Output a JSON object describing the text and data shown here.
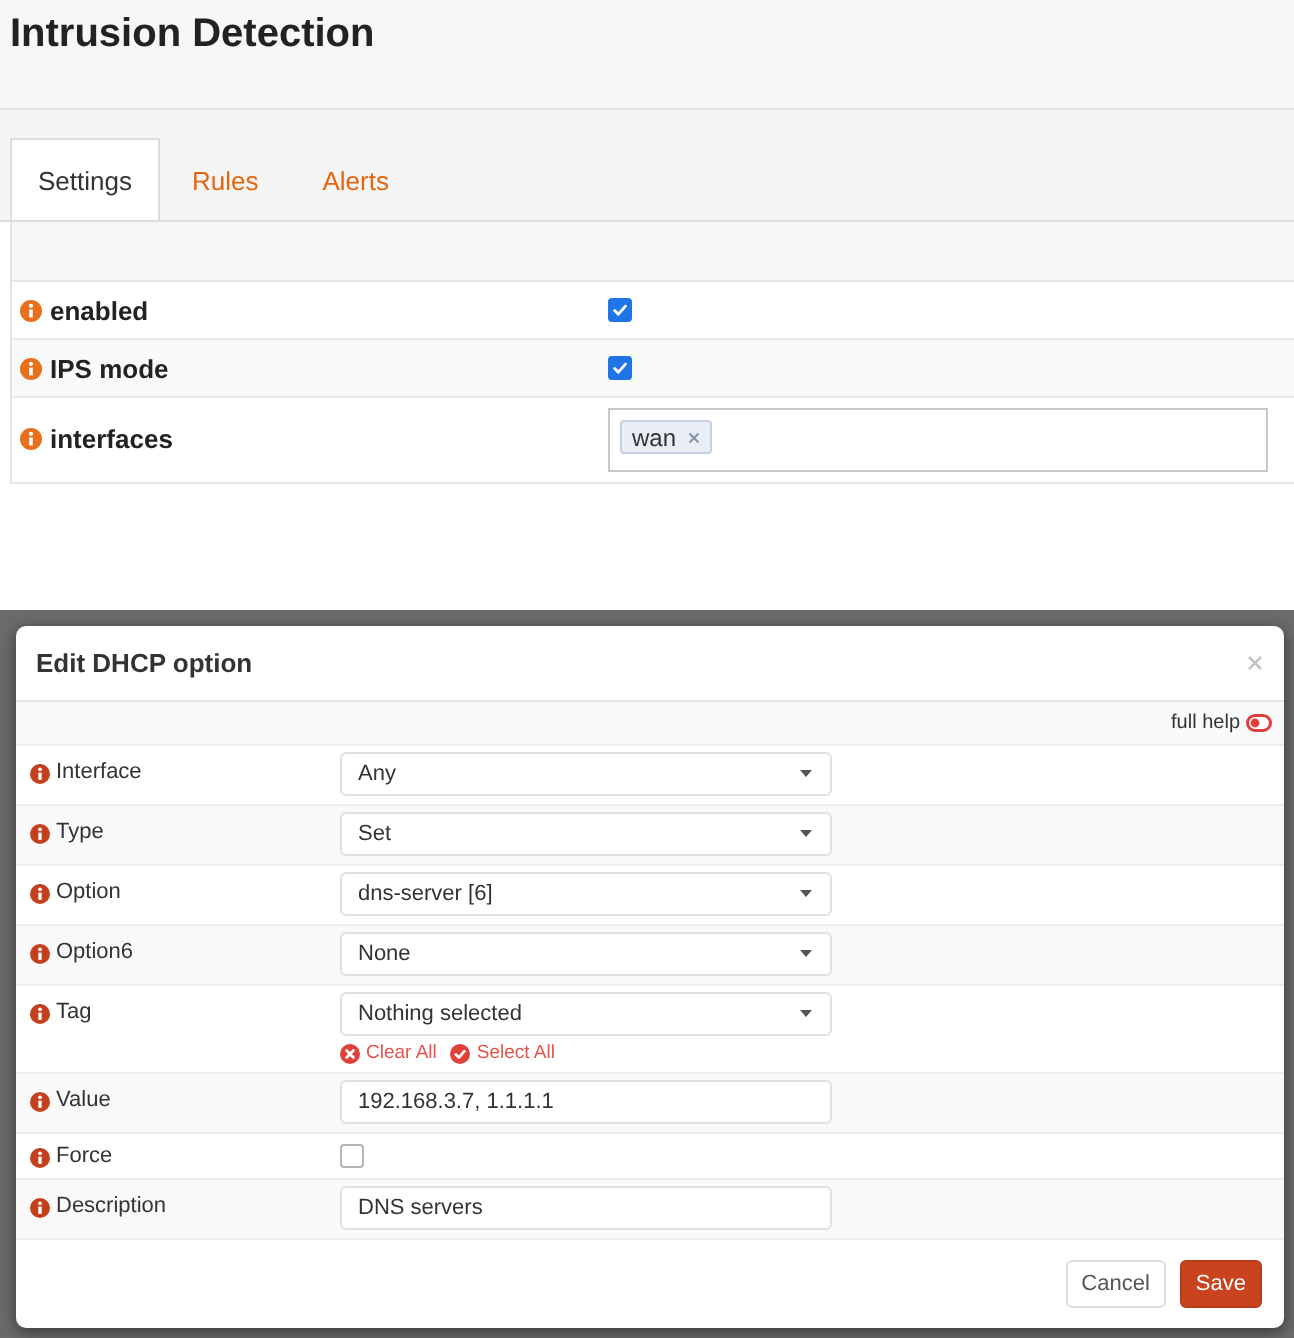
{
  "page": {
    "title": "Intrusion Detection"
  },
  "tabs": [
    {
      "label": "Settings",
      "selected": true
    },
    {
      "label": "Rules",
      "selected": false
    },
    {
      "label": "Alerts",
      "selected": false
    }
  ],
  "settings": [
    {
      "kind": "checkbox",
      "label": "enabled",
      "checked": true
    },
    {
      "kind": "checkbox",
      "label": "IPS mode",
      "checked": true
    },
    {
      "kind": "tags",
      "label": "interfaces",
      "tags": [
        {
          "label": "wan"
        }
      ]
    }
  ],
  "dialog": {
    "title": "Edit DHCP option",
    "help": {
      "label": "full help",
      "on": false
    },
    "fields": [
      {
        "kind": "select",
        "label": "Interface",
        "value": "Any"
      },
      {
        "kind": "select",
        "label": "Type",
        "value": "Set"
      },
      {
        "kind": "select",
        "label": "Option",
        "value": "dns-server [6]"
      },
      {
        "kind": "select",
        "label": "Option6",
        "value": "None"
      },
      {
        "kind": "multiselect",
        "label": "Tag",
        "value": "Nothing selected",
        "actions": [
          {
            "label": "Clear All",
            "kind": "clear"
          },
          {
            "label": "Select All",
            "kind": "select"
          }
        ]
      },
      {
        "kind": "text",
        "label": "Value",
        "value": "192.168.3.7, 1.1.1.1"
      },
      {
        "kind": "checkbox",
        "label": "Force",
        "checked": false
      },
      {
        "kind": "text",
        "label": "Description",
        "value": "DNS servers"
      }
    ],
    "buttons": [
      {
        "label": "Cancel",
        "kind": "default"
      },
      {
        "label": "Save",
        "kind": "primary"
      }
    ]
  }
}
